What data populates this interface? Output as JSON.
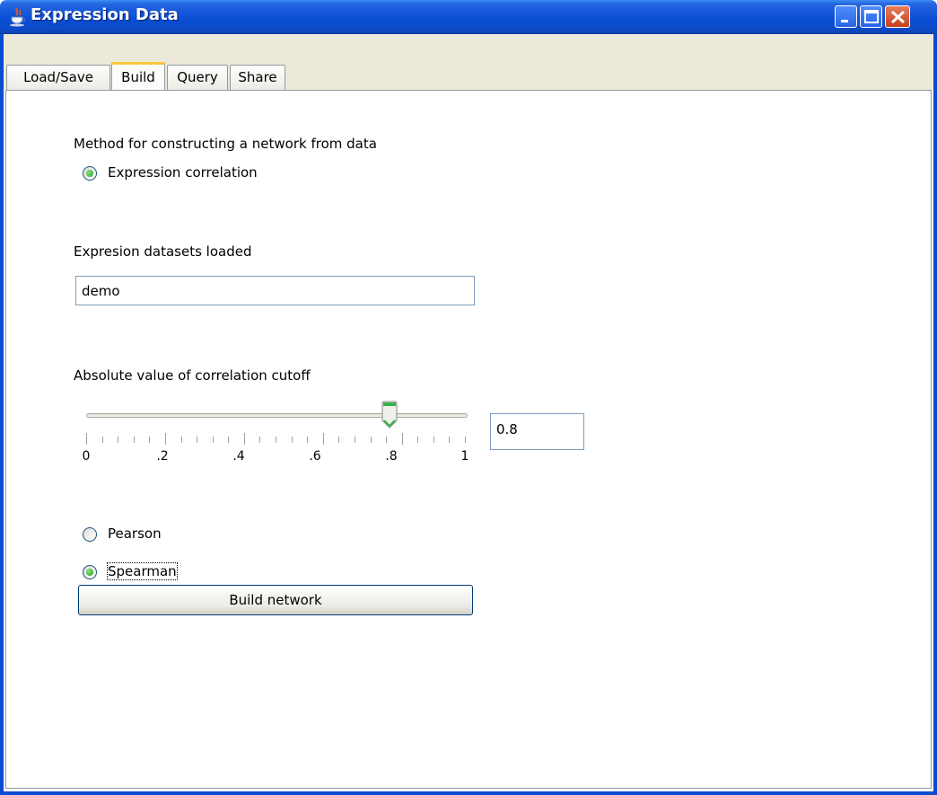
{
  "window": {
    "title": "Expression Data",
    "app_icon": "java-cup-icon"
  },
  "title_buttons": {
    "minimize": "minimize-icon",
    "maximize": "maximize-icon",
    "close": "close-icon"
  },
  "tabs": [
    {
      "label": "Load/Save",
      "active": false
    },
    {
      "label": "Build",
      "active": true
    },
    {
      "label": "Query",
      "active": false
    },
    {
      "label": "Share",
      "active": false
    }
  ],
  "method": {
    "heading": "Method for constructing a network from data",
    "option_label": "Expression correlation",
    "selected": true
  },
  "datasets": {
    "heading": "Expresion datasets loaded",
    "value": "demo"
  },
  "cutoff": {
    "heading": "Absolute value of correlation cutoff",
    "value": "0.8",
    "slider_fraction": 0.8,
    "tick_labels": [
      "0",
      ".2",
      ".4",
      ".6",
      ".8",
      "1"
    ]
  },
  "correlation_type": {
    "pearson_label": "Pearson",
    "spearman_label": "Spearman",
    "selected": "Spearman"
  },
  "build_button_label": "Build network",
  "colors": {
    "titlebar": "#0a4ed4",
    "accent_tab": "#ffc83c",
    "radio_dot": "#21a121",
    "close_button": "#c8411b"
  }
}
